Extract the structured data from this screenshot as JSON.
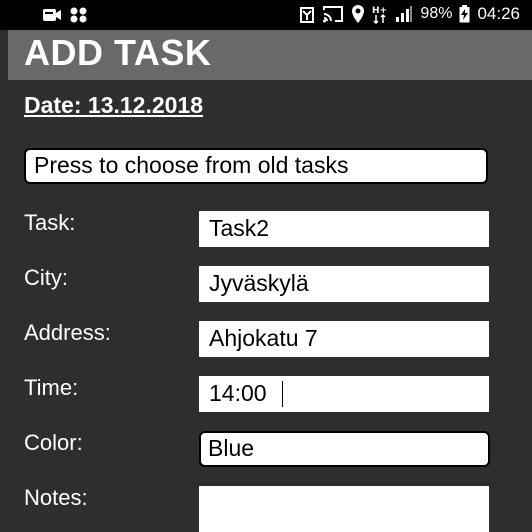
{
  "status_bar": {
    "left_icons": [
      "screen-record-icon",
      "app-grid-icon"
    ],
    "right_icons": [
      "battery-saver-icon",
      "cast-icon",
      "location-icon",
      "hplus-data-icon",
      "signal-icon",
      "charging-icon"
    ],
    "battery_percent": "98%",
    "clock": "04:26"
  },
  "header": {
    "title": "ADD TASK",
    "bar_color": "#6b6968"
  },
  "date_label": "Date: 13.12.2018",
  "old_tasks_button": {
    "label": "Press to choose from old tasks"
  },
  "form": {
    "task": {
      "label": "Task:",
      "value": "Task2"
    },
    "city": {
      "label": "City:",
      "value": "Jyväskylä"
    },
    "address": {
      "label": "Address:",
      "value": "Ahjokatu 7"
    },
    "time": {
      "label": "Time:",
      "value": "14:00"
    },
    "color": {
      "label": "Color:",
      "value": "Blue"
    },
    "notes": {
      "label": "Notes:",
      "value": ""
    }
  },
  "colors": {
    "background": "#2e2e2e",
    "text": "#ffffff",
    "field": "#ffffff"
  }
}
